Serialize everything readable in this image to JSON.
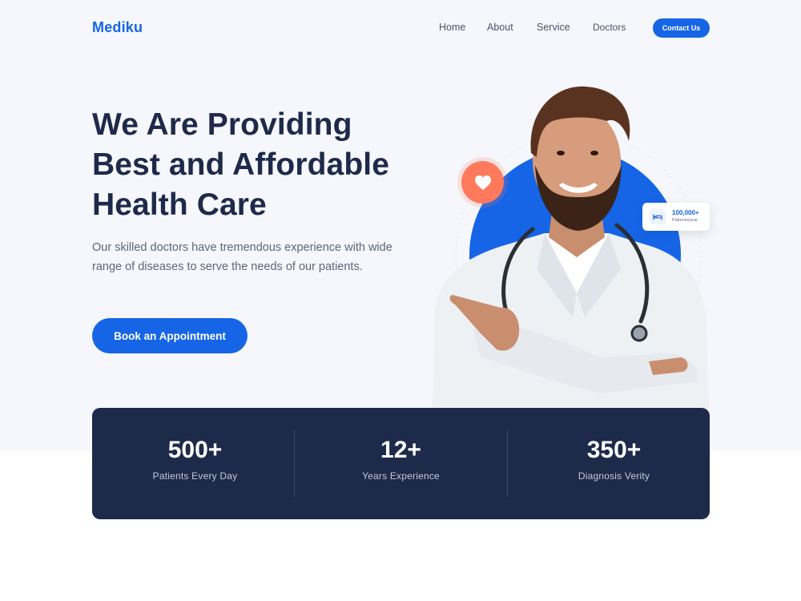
{
  "brand": {
    "logo": "Mediku"
  },
  "nav": {
    "links": [
      "Home",
      "About",
      "Service",
      "Doctors"
    ],
    "contact_label": "Contact Us"
  },
  "hero": {
    "headline": [
      "We Are Providing",
      "Best and Affordable",
      "Health Care"
    ],
    "description": "Our skilled doctors have tremendous experience with wide range of diseases to serve the needs of our patients.",
    "cta_label": "Book an Appointment",
    "badge_icon": "heart-icon",
    "stat_card": {
      "icon": "bed-icon",
      "value": "100,000+",
      "label": "Patients/year"
    }
  },
  "stats": [
    {
      "value": "500+",
      "label": "Patients Every Day"
    },
    {
      "value": "12+",
      "label": "Years Experience"
    },
    {
      "value": "350+",
      "label": "Diagnosis Verity"
    }
  ],
  "colors": {
    "primary": "#1565e6",
    "navy": "#1e2a4a",
    "accent": "#ff7a5c",
    "hero_bg": "#f5f7fc"
  }
}
